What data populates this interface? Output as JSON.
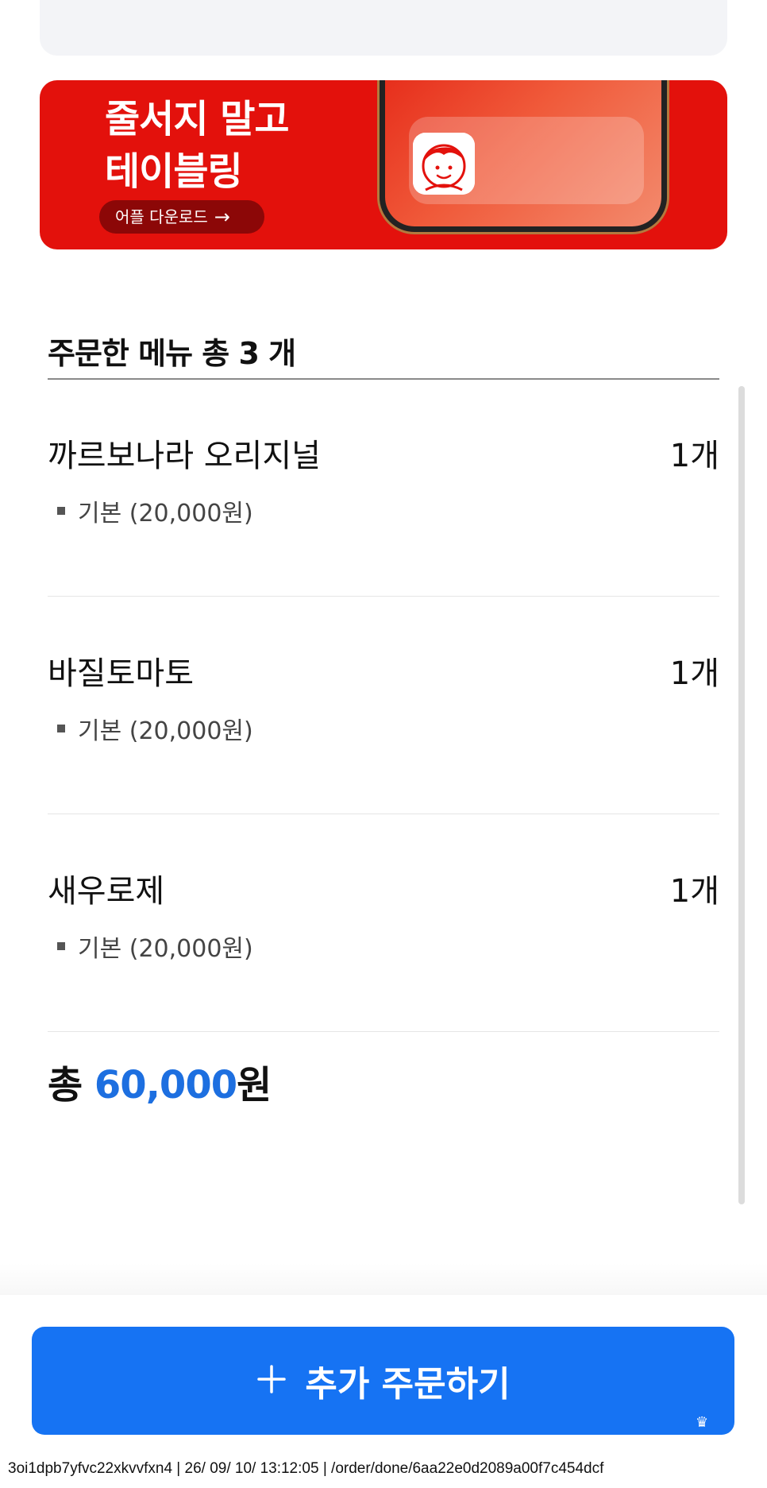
{
  "banner": {
    "title_line1": "줄서지 말고",
    "title_line2": "테이블링",
    "download_label": "어플 다운로드",
    "download_arrow": "→",
    "brand_color": "#e3110c"
  },
  "order": {
    "section_title": "주문한 메뉴 총 3 개",
    "items": [
      {
        "name": "까르보나라 오리지널",
        "qty": "1개",
        "option": "기본 (20,000원)"
      },
      {
        "name": "바질토마토",
        "qty": "1개",
        "option": "기본 (20,000원)"
      },
      {
        "name": "새우로제",
        "qty": "1개",
        "option": "기본 (20,000원)"
      }
    ],
    "total_prefix": "총",
    "total_amount": "60,000",
    "total_suffix": "원",
    "accent_color": "#1d6fe0"
  },
  "cta": {
    "icon": "plus-icon",
    "label": "추가 주문하기",
    "color": "#1673f3"
  },
  "footer": {
    "meta": "3oi1dpb7yfvc22xkvvfxn4 | 26/ 09/ 10/ 13:12:05 | /order/done/6aa22e0d2089a00f7c454dcf"
  }
}
